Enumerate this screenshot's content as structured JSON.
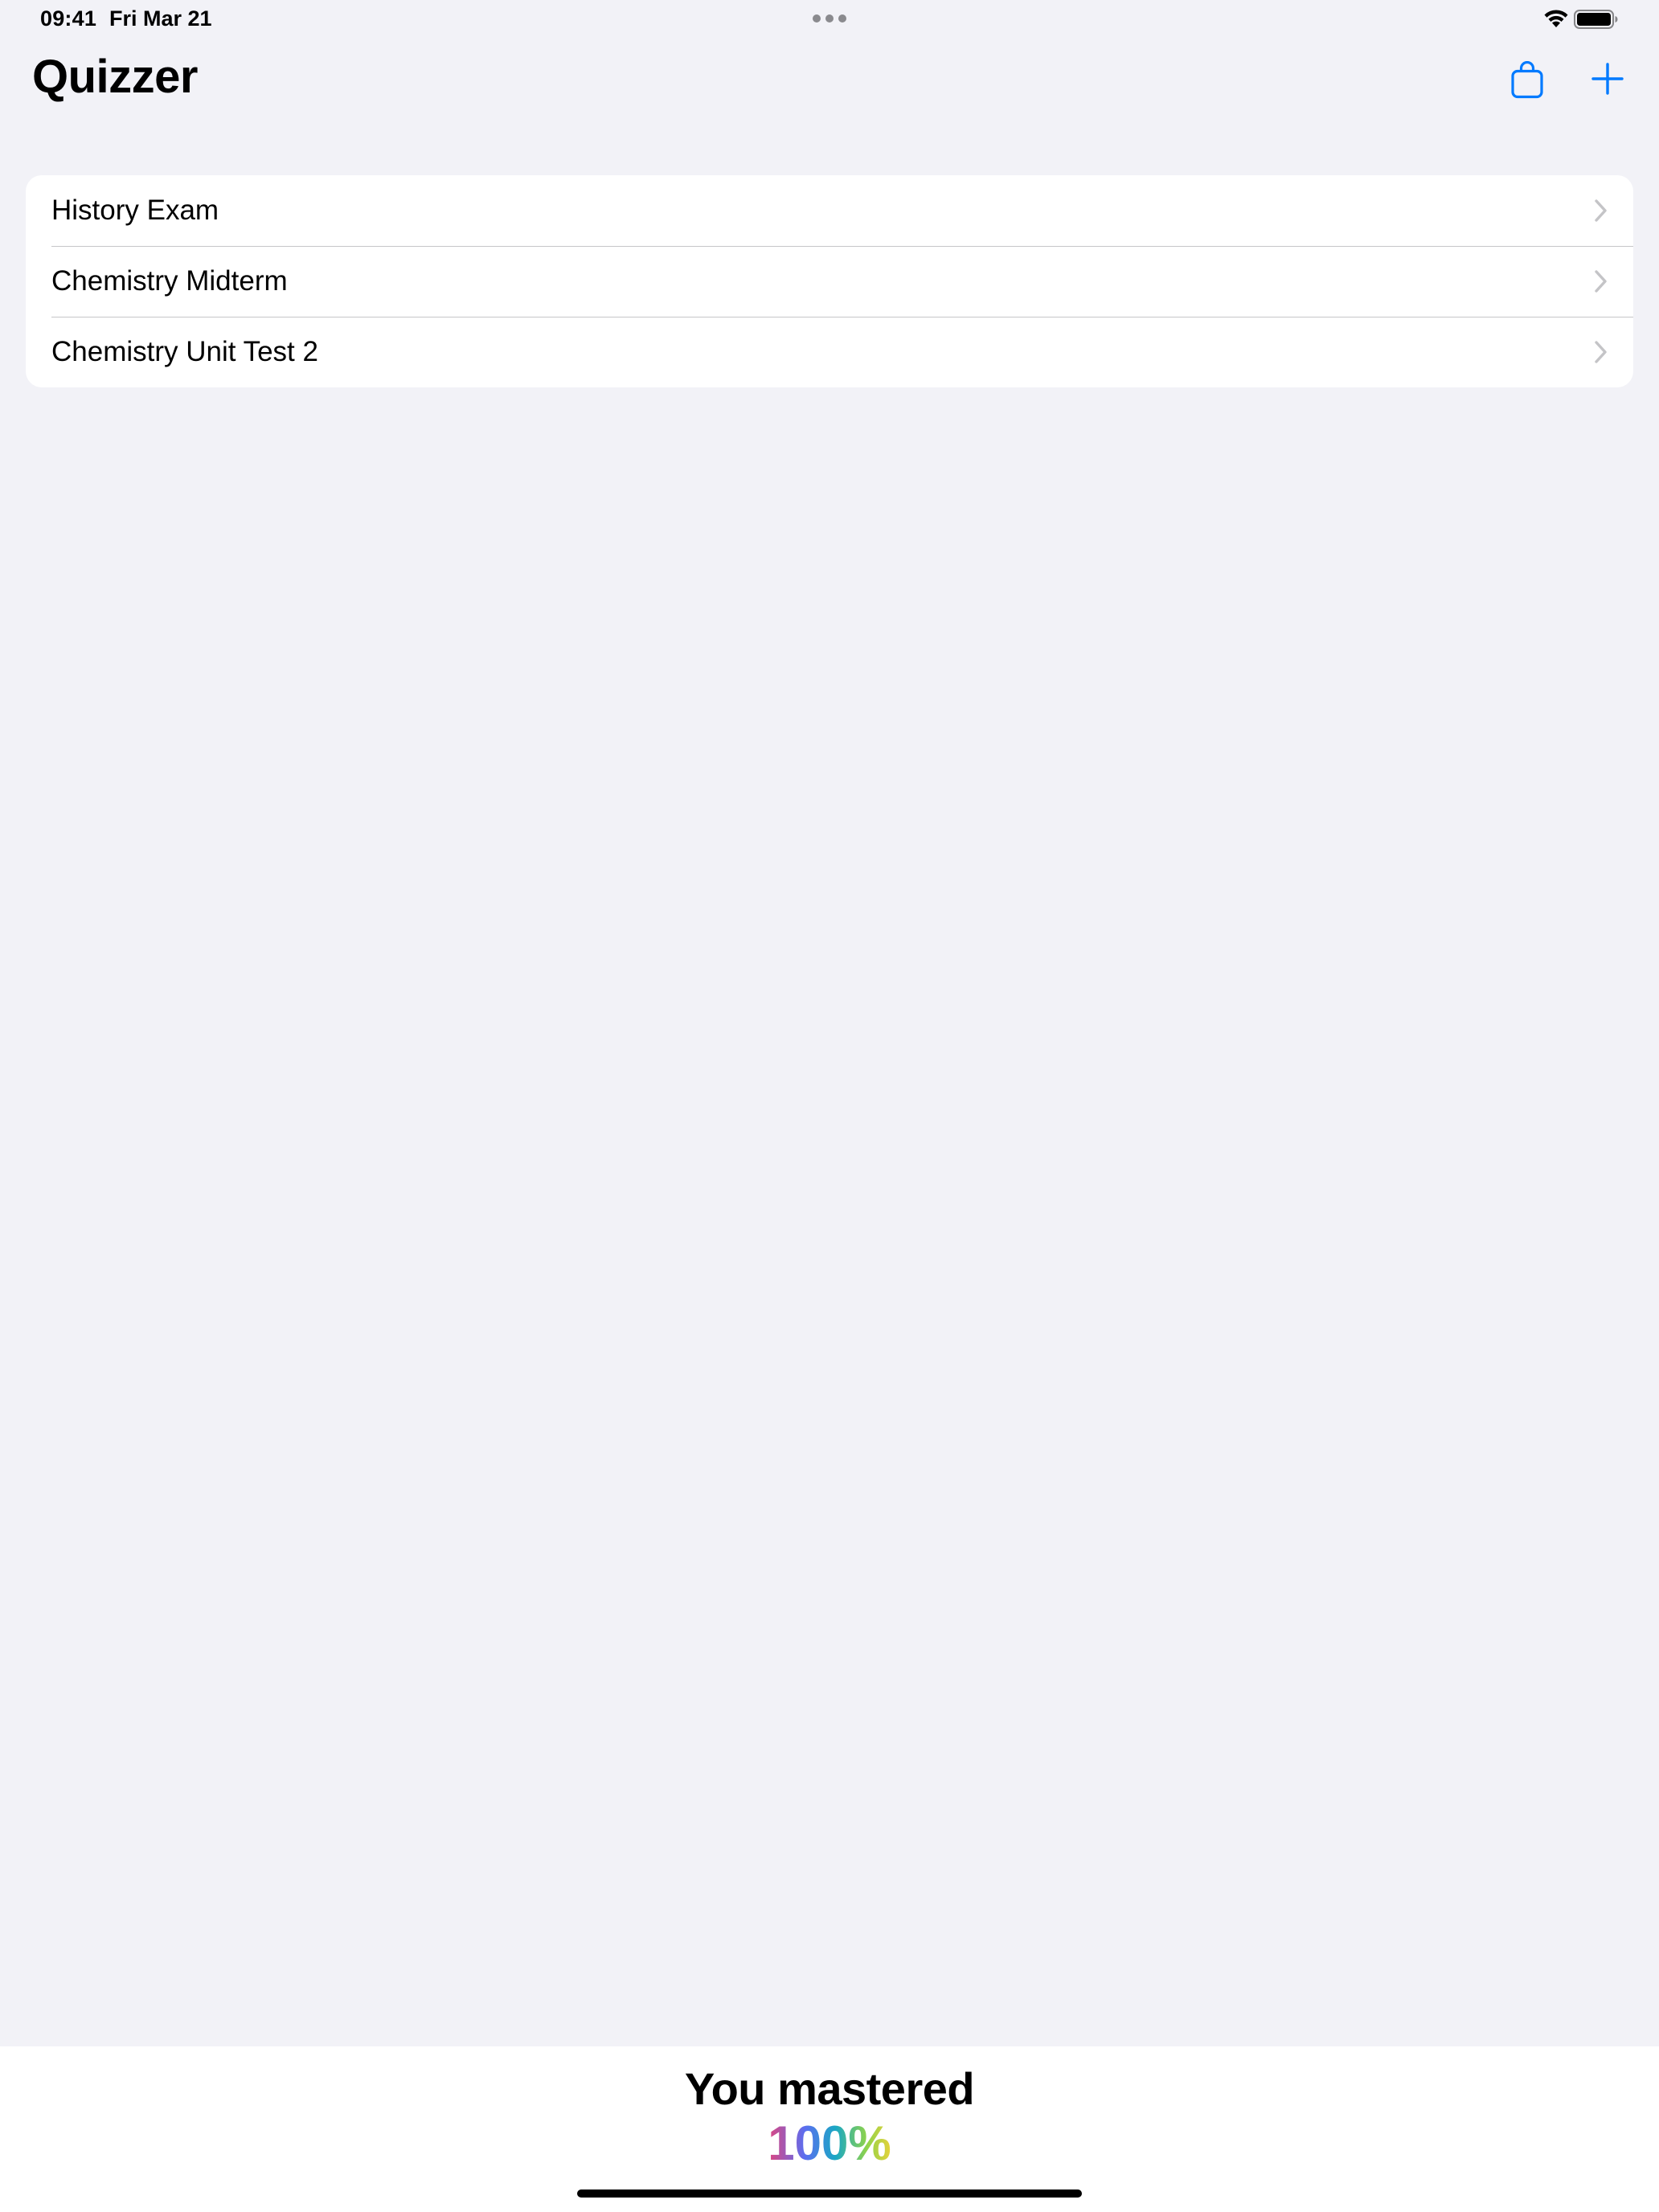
{
  "status_bar": {
    "time": "09:41",
    "date": "Fri Mar 21",
    "icons": [
      "multitask-dots-icon",
      "wifi-icon",
      "battery-icon"
    ]
  },
  "nav": {
    "title": "Quizzer",
    "buttons": [
      {
        "name": "bag-button",
        "icon": "shopping-bag-icon"
      },
      {
        "name": "add-button",
        "icon": "plus-icon"
      }
    ]
  },
  "quizzes": [
    {
      "label": "History Exam"
    },
    {
      "label": "Chemistry Midterm"
    },
    {
      "label": "Chemistry Unit Test 2"
    }
  ],
  "mastery": {
    "label": "You mastered",
    "value": "100%",
    "fraction": 1.0
  },
  "colors": {
    "accent": "#007aff",
    "background": "#f2f2f7",
    "card": "#ffffff",
    "chevron": "#c4c4c7"
  }
}
